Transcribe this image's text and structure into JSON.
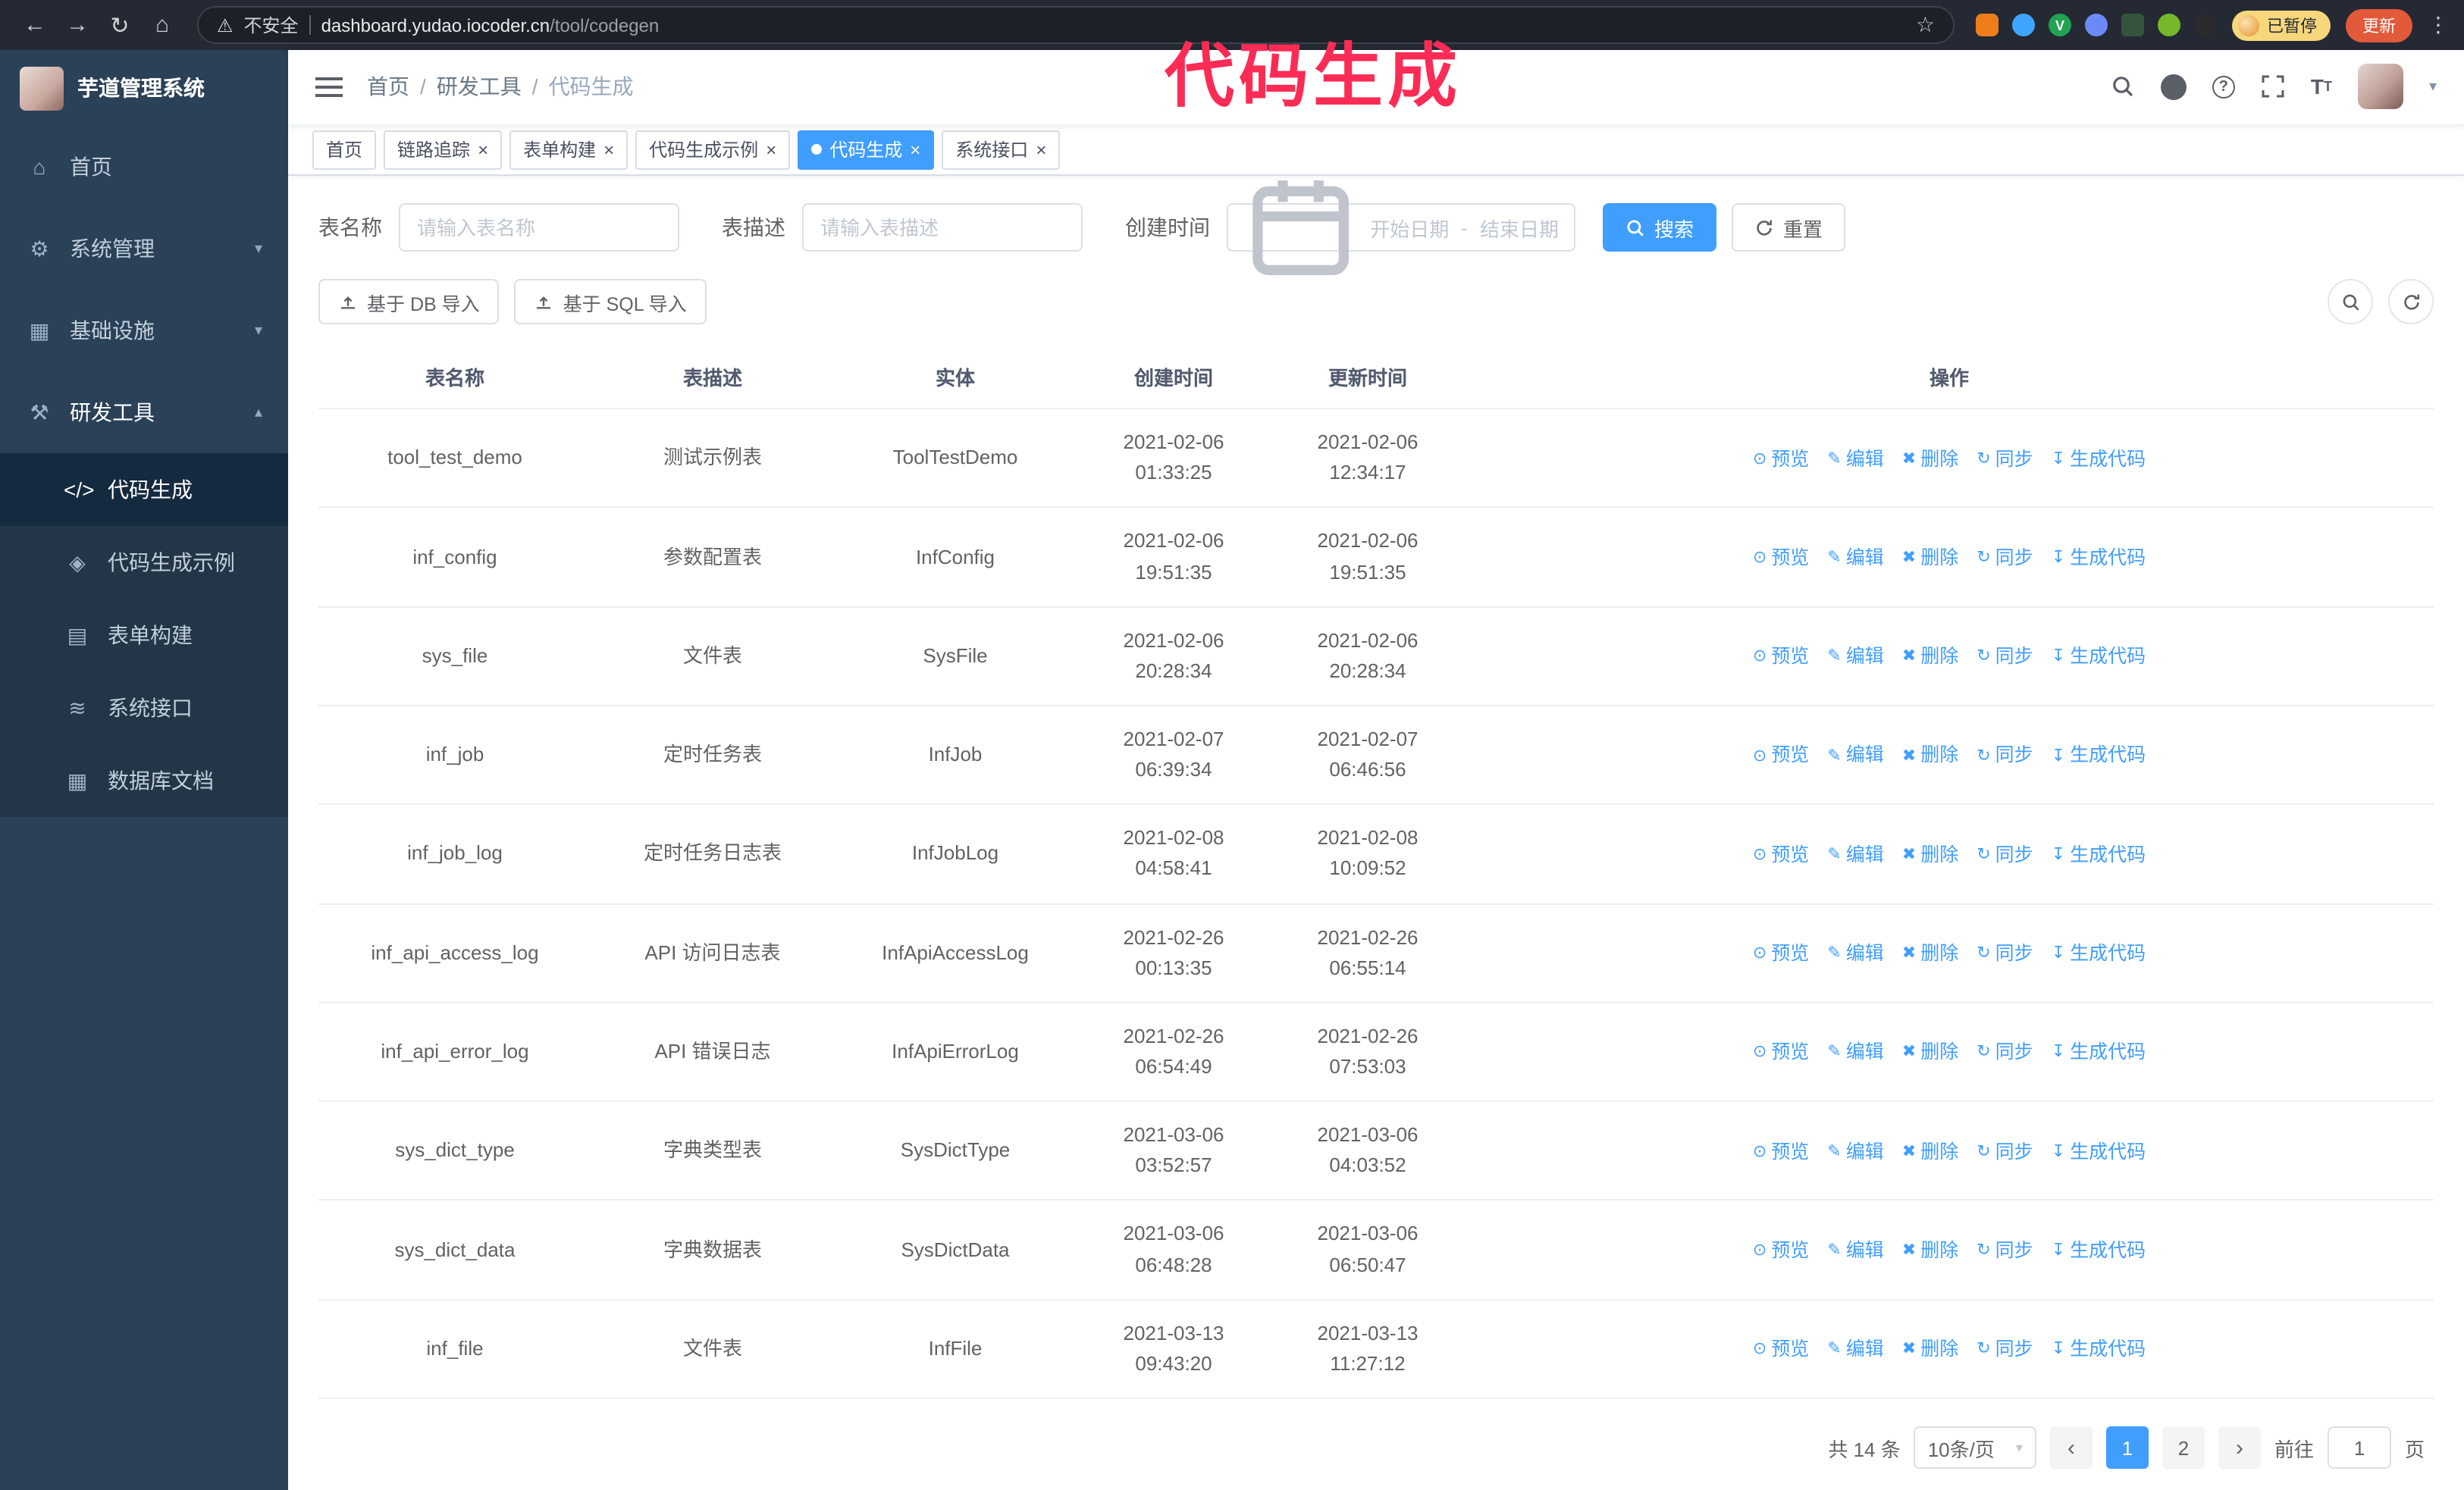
{
  "annotation": {
    "text": "代码生成",
    "color": "#fa2c55"
  },
  "colors": {
    "accent": "#409eff",
    "sidebar_bg": "#2a4158",
    "annotation_pink": "#fa2c55",
    "update_button": "#e25a3a"
  },
  "browser": {
    "security_label": "不安全",
    "url_domain": "dashboard.yudao.iocoder.cn",
    "url_path": "/tool/codegen",
    "paused_badge": "已暂停",
    "update_button": "更新"
  },
  "sidebar": {
    "app_title": "芋道管理系统",
    "items": [
      {
        "key": "home",
        "icon": "home-icon",
        "label": "首页"
      },
      {
        "key": "system",
        "icon": "gear-icon",
        "label": "系统管理",
        "chevron": "down"
      },
      {
        "key": "infra",
        "icon": "infra-icon",
        "label": "基础设施",
        "chevron": "down"
      },
      {
        "key": "devtools",
        "icon": "tools-icon",
        "label": "研发工具",
        "chevron": "up",
        "expanded": true,
        "children": [
          {
            "key": "codegen",
            "icon": "code-icon",
            "label": "代码生成",
            "active": true
          },
          {
            "key": "codegen-example",
            "icon": "example-icon",
            "label": "代码生成示例"
          },
          {
            "key": "form-build",
            "icon": "form-icon",
            "label": "表单构建"
          },
          {
            "key": "api",
            "icon": "api-icon",
            "label": "系统接口"
          },
          {
            "key": "db-doc",
            "icon": "dbdoc-icon",
            "label": "数据库文档"
          }
        ]
      }
    ]
  },
  "breadcrumb": [
    "首页",
    "研发工具",
    "代码生成"
  ],
  "tabs": [
    {
      "label": "首页",
      "closable": false,
      "active": false
    },
    {
      "label": "链路追踪",
      "closable": true,
      "active": false
    },
    {
      "label": "表单构建",
      "closable": true,
      "active": false
    },
    {
      "label": "代码生成示例",
      "closable": true,
      "active": false
    },
    {
      "label": "代码生成",
      "closable": true,
      "active": true
    },
    {
      "label": "系统接口",
      "closable": true,
      "active": false
    }
  ],
  "search": {
    "table_name_label": "表名称",
    "table_name_placeholder": "请输入表名称",
    "table_desc_label": "表描述",
    "table_desc_placeholder": "请输入表描述",
    "create_time_label": "创建时间",
    "date_start_placeholder": "开始日期",
    "date_separator": "-",
    "date_end_placeholder": "结束日期",
    "search_button": "搜索",
    "reset_button": "重置"
  },
  "toolbar": {
    "import_db_button": "基于 DB 导入",
    "import_sql_button": "基于 SQL 导入"
  },
  "table": {
    "columns": [
      "表名称",
      "表描述",
      "实体",
      "创建时间",
      "更新时间",
      "操作"
    ],
    "actions": [
      "预览",
      "编辑",
      "删除",
      "同步",
      "生成代码"
    ],
    "rows": [
      {
        "name": "tool_test_demo",
        "desc": "测试示例表",
        "entity": "ToolTestDemo",
        "created": "2021-02-06 01:33:25",
        "updated": "2021-02-06 12:34:17"
      },
      {
        "name": "inf_config",
        "desc": "参数配置表",
        "entity": "InfConfig",
        "created": "2021-02-06 19:51:35",
        "updated": "2021-02-06 19:51:35"
      },
      {
        "name": "sys_file",
        "desc": "文件表",
        "entity": "SysFile",
        "created": "2021-02-06 20:28:34",
        "updated": "2021-02-06 20:28:34"
      },
      {
        "name": "inf_job",
        "desc": "定时任务表",
        "entity": "InfJob",
        "created": "2021-02-07 06:39:34",
        "updated": "2021-02-07 06:46:56"
      },
      {
        "name": "inf_job_log",
        "desc": "定时任务日志表",
        "entity": "InfJobLog",
        "created": "2021-02-08 04:58:41",
        "updated": "2021-02-08 10:09:52"
      },
      {
        "name": "inf_api_access_log",
        "desc": "API 访问日志表",
        "entity": "InfApiAccessLog",
        "created": "2021-02-26 00:13:35",
        "updated": "2021-02-26 06:55:14"
      },
      {
        "name": "inf_api_error_log",
        "desc": "API 错误日志",
        "entity": "InfApiErrorLog",
        "created": "2021-02-26 06:54:49",
        "updated": "2021-02-26 07:53:03"
      },
      {
        "name": "sys_dict_type",
        "desc": "字典类型表",
        "entity": "SysDictType",
        "created": "2021-03-06 03:52:57",
        "updated": "2021-03-06 04:03:52"
      },
      {
        "name": "sys_dict_data",
        "desc": "字典数据表",
        "entity": "SysDictData",
        "created": "2021-03-06 06:48:28",
        "updated": "2021-03-06 06:50:47"
      },
      {
        "name": "inf_file",
        "desc": "文件表",
        "entity": "InfFile",
        "created": "2021-03-13 09:43:20",
        "updated": "2021-03-13 11:27:12"
      }
    ]
  },
  "pagination": {
    "total_text": "共 14 条",
    "page_size": "10条/页",
    "pages": [
      "1",
      "2"
    ],
    "active_page": "1",
    "goto_label": "前往",
    "goto_value": "1",
    "goto_unit": "页"
  }
}
